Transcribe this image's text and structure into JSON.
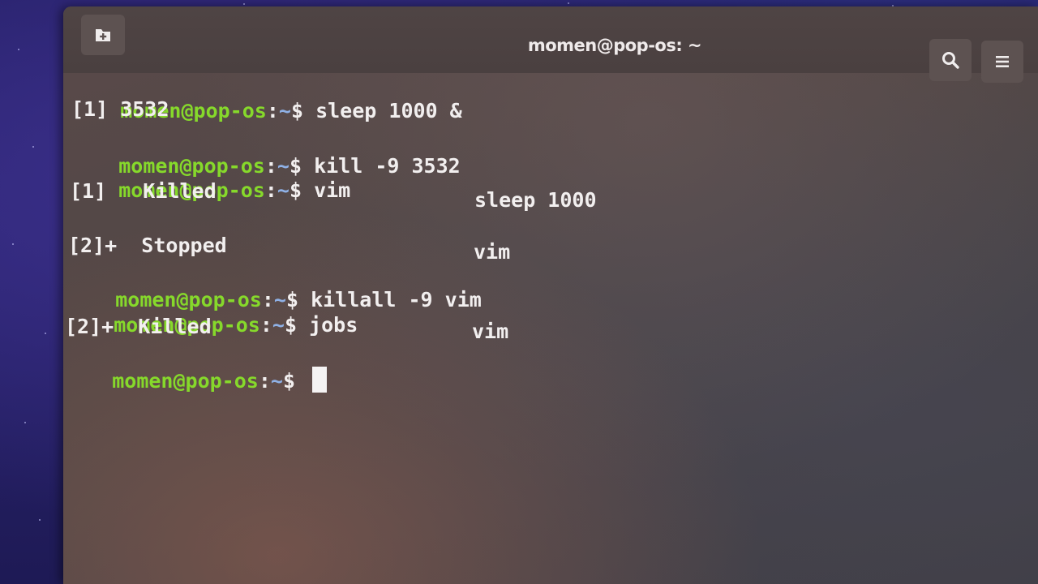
{
  "window": {
    "title": "momen@pop-os: ~"
  },
  "icons": {
    "new_tab": "new-tab-icon",
    "search": "search-icon",
    "menu": "hamburger-menu-icon"
  },
  "colors": {
    "prompt_user": "#86d92b",
    "prompt_path": "#8fb1e6",
    "text": "#f2efef"
  },
  "prompt": {
    "user_host": "momen@pop-os",
    "separator": ":",
    "path": "~",
    "symbol": "$"
  },
  "lines": [
    {
      "type": "cmd",
      "text": " sleep 1000 &"
    },
    {
      "type": "out",
      "text": "[1] 3532"
    },
    {
      "type": "cmd",
      "text": " kill -9 3532"
    },
    {
      "type": "cmd",
      "text": " vim"
    },
    {
      "type": "job",
      "label": "[1]   Killed",
      "command": "sleep 1000"
    },
    {
      "type": "job",
      "label": "[2]+  Stopped",
      "command": "vim"
    },
    {
      "type": "cmd",
      "text": " killall -9 vim"
    },
    {
      "type": "cmd",
      "text": " jobs"
    },
    {
      "type": "job",
      "label": "[2]+  Killed",
      "command": "vim"
    },
    {
      "type": "cmd",
      "text": " "
    }
  ]
}
